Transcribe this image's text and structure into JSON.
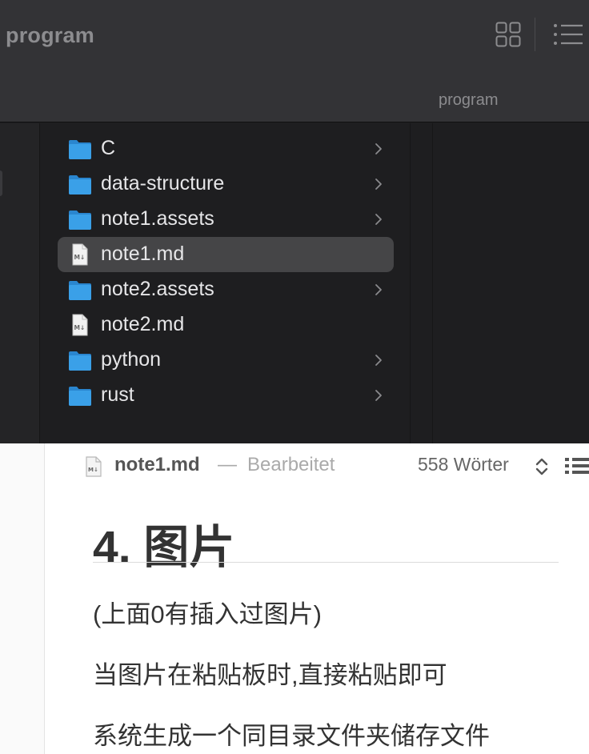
{
  "finder": {
    "window_title": "program",
    "path_label": "program",
    "items": [
      {
        "name": "C",
        "kind": "folder",
        "has_children": true,
        "selected": false
      },
      {
        "name": "data-structure",
        "kind": "folder",
        "has_children": true,
        "selected": false
      },
      {
        "name": "note1.assets",
        "kind": "folder",
        "has_children": true,
        "selected": false
      },
      {
        "name": "note1.md",
        "kind": "markdown",
        "has_children": false,
        "selected": true
      },
      {
        "name": "note2.assets",
        "kind": "folder",
        "has_children": true,
        "selected": false
      },
      {
        "name": "note2.md",
        "kind": "markdown",
        "has_children": false,
        "selected": false
      },
      {
        "name": "python",
        "kind": "folder",
        "has_children": true,
        "selected": false
      },
      {
        "name": "rust",
        "kind": "folder",
        "has_children": true,
        "selected": false
      }
    ],
    "toolbar_icons": [
      "grid-view-icon",
      "list-view-icon"
    ]
  },
  "editor": {
    "doc_name": "note1.md",
    "doc_dash": "—",
    "doc_status": "Bearbeitet",
    "word_count": "558 Wörter",
    "heading": "4. 图片",
    "paragraphs": [
      "(上面0有插入过图片)",
      "当图片在粘贴板时,直接粘贴即可",
      "系统生成一个同目录文件夹储存文件"
    ]
  },
  "colors": {
    "folder_blue": "#3aa0e8",
    "finder_bg": "#1e1e20",
    "toolbar_bg": "#333336",
    "selection": "#454547",
    "editor_text": "#333333"
  }
}
